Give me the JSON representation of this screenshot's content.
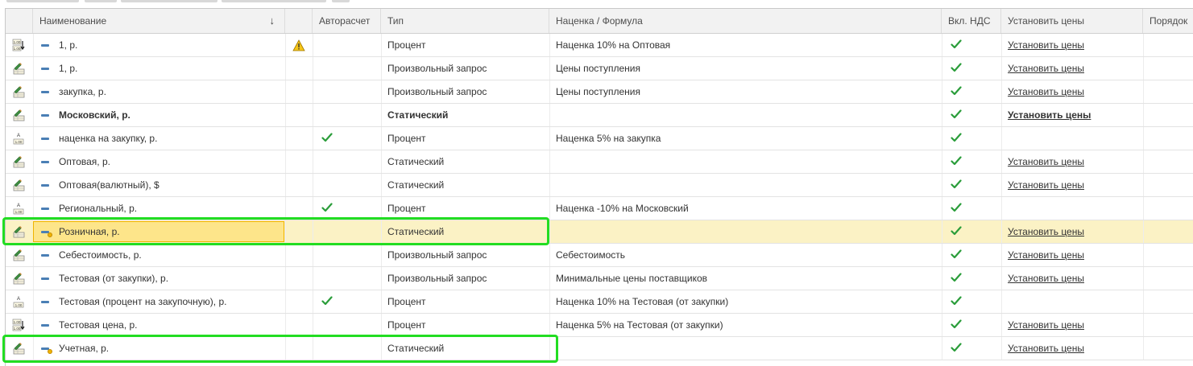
{
  "headers": {
    "name": "Наименование",
    "name_sort": "↓",
    "blank": "",
    "autocalc": "Авторасчет",
    "type": "Тип",
    "markup": "Наценка / Формула",
    "vat": "Вкл. НДС",
    "set_prices": "Установить цены",
    "order": "Порядок"
  },
  "rows": [
    {
      "icon": "rate-icon-a",
      "name": "1, р.",
      "warn": true,
      "auto": false,
      "type": "Процент",
      "markup": "Наценка 10% на Оптовая",
      "vat": true,
      "set": "Установить цены",
      "bold": false,
      "sel": false,
      "main": false
    },
    {
      "icon": "edit-table-icon",
      "name": "1, р.",
      "warn": false,
      "auto": false,
      "type": "Произвольный запрос",
      "markup": "Цены поступления",
      "vat": true,
      "set": "Установить цены",
      "bold": false,
      "sel": false,
      "main": false
    },
    {
      "icon": "edit-table-icon",
      "name": "закупка, р.",
      "warn": false,
      "auto": false,
      "type": "Произвольный запрос",
      "markup": "Цены поступления",
      "vat": true,
      "set": "Установить цены",
      "bold": false,
      "sel": false,
      "main": false
    },
    {
      "icon": "edit-table-icon",
      "name": "Московский, р.",
      "warn": false,
      "auto": false,
      "type": "Статический",
      "markup": "",
      "vat": true,
      "set": "Установить цены",
      "bold": true,
      "sel": false,
      "main": false
    },
    {
      "icon": "rate-icon-b",
      "name": "наценка на закупку, р.",
      "warn": false,
      "auto": true,
      "type": "Процент",
      "markup": "Наценка 5% на закупка",
      "vat": true,
      "set": "",
      "bold": false,
      "sel": false,
      "main": false
    },
    {
      "icon": "edit-table-icon",
      "name": "Оптовая, р.",
      "warn": false,
      "auto": false,
      "type": "Статический",
      "markup": "",
      "vat": true,
      "set": "Установить цены",
      "bold": false,
      "sel": false,
      "main": false
    },
    {
      "icon": "edit-table-icon",
      "name": "Оптовая(валютный), $",
      "warn": false,
      "auto": false,
      "type": "Статический",
      "markup": "",
      "vat": true,
      "set": "Установить цены",
      "bold": false,
      "sel": false,
      "main": false
    },
    {
      "icon": "rate-icon-b",
      "name": "Региональный, р.",
      "warn": false,
      "auto": true,
      "type": "Процент",
      "markup": "Наценка -10% на Московский",
      "vat": true,
      "set": "",
      "bold": false,
      "sel": false,
      "main": false
    },
    {
      "icon": "edit-table-icon",
      "name": "Розничная, р.",
      "warn": false,
      "auto": false,
      "type": "Статический",
      "markup": "",
      "vat": true,
      "set": "Установить цены",
      "bold": false,
      "sel": true,
      "main": true
    },
    {
      "icon": "edit-table-icon",
      "name": "Себестоимость, р.",
      "warn": false,
      "auto": false,
      "type": "Произвольный запрос",
      "markup": "Себестоимость",
      "vat": true,
      "set": "Установить цены",
      "bold": false,
      "sel": false,
      "main": false
    },
    {
      "icon": "edit-table-icon",
      "name": "Тестовая (от закупки), р.",
      "warn": false,
      "auto": false,
      "type": "Произвольный запрос",
      "markup": "Минимальные цены поставщиков",
      "vat": true,
      "set": "Установить цены",
      "bold": false,
      "sel": false,
      "main": false
    },
    {
      "icon": "rate-icon-b",
      "name": "Тестовая (процент на закупочную), р.",
      "warn": false,
      "auto": true,
      "type": "Процент",
      "markup": "Наценка 10% на Тестовая (от закупки)",
      "vat": true,
      "set": "",
      "bold": false,
      "sel": false,
      "main": false
    },
    {
      "icon": "rate-icon-a",
      "name": "Тестовая цена, р.",
      "warn": false,
      "auto": false,
      "type": "Процент",
      "markup": "Наценка 5% на Тестовая (от закупки)",
      "vat": true,
      "set": "Установить цены",
      "bold": false,
      "sel": false,
      "main": false
    },
    {
      "icon": "edit-table-icon",
      "name": "Учетная, р.",
      "warn": false,
      "auto": false,
      "type": "Статический",
      "markup": "",
      "vat": true,
      "set": "Установить цены",
      "bold": false,
      "sel": false,
      "main": true
    }
  ],
  "colors": {
    "header_bg": "#f2f2f2",
    "selected_row": "#fbf2c5",
    "focus_cell": "#fde58a",
    "check": "#2a9d3a",
    "highlight": "#22dd22"
  }
}
